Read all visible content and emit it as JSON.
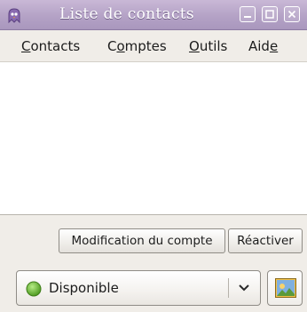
{
  "window": {
    "title": "Liste de contacts"
  },
  "menu": {
    "items": [
      {
        "label": "Contacts",
        "mnemonic": "C"
      },
      {
        "label": "Comptes",
        "mnemonic": "o"
      },
      {
        "label": "Outils",
        "mnemonic": "O"
      },
      {
        "label": "Aide",
        "mnemonic": "e"
      }
    ]
  },
  "account_buttons": {
    "modify_label": "Modification du compte",
    "reactivate_label": "Réactiver"
  },
  "status": {
    "selected": "Disponible",
    "indicator_icon": "available-status-icon",
    "indicator_color": "#6fbf3a"
  },
  "icons": {
    "app": "pidgin-app-icon",
    "minimize": "minimize-icon",
    "maximize": "maximize-icon",
    "close": "close-icon",
    "dropdown": "chevron-down-icon",
    "buddy_icon": "buddy-icon"
  },
  "colors": {
    "titlebar": "#b4a2c6",
    "window_bg": "#f0ede8",
    "list_bg": "#ffffff"
  }
}
